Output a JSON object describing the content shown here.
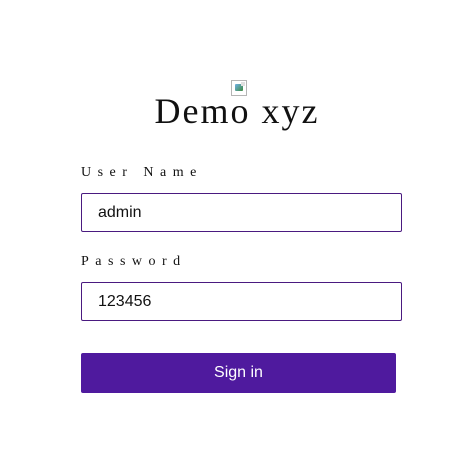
{
  "header": {
    "logo_icon": "broken-image-icon",
    "title": "Demo xyz"
  },
  "form": {
    "username": {
      "label": "User Name",
      "value": "admin"
    },
    "password": {
      "label": "Password",
      "value": "123456"
    },
    "submit_label": "Sign in"
  },
  "colors": {
    "accent": "#4f1a9e",
    "input_border": "#4a1a80",
    "text": "#111111",
    "background": "#ffffff"
  }
}
